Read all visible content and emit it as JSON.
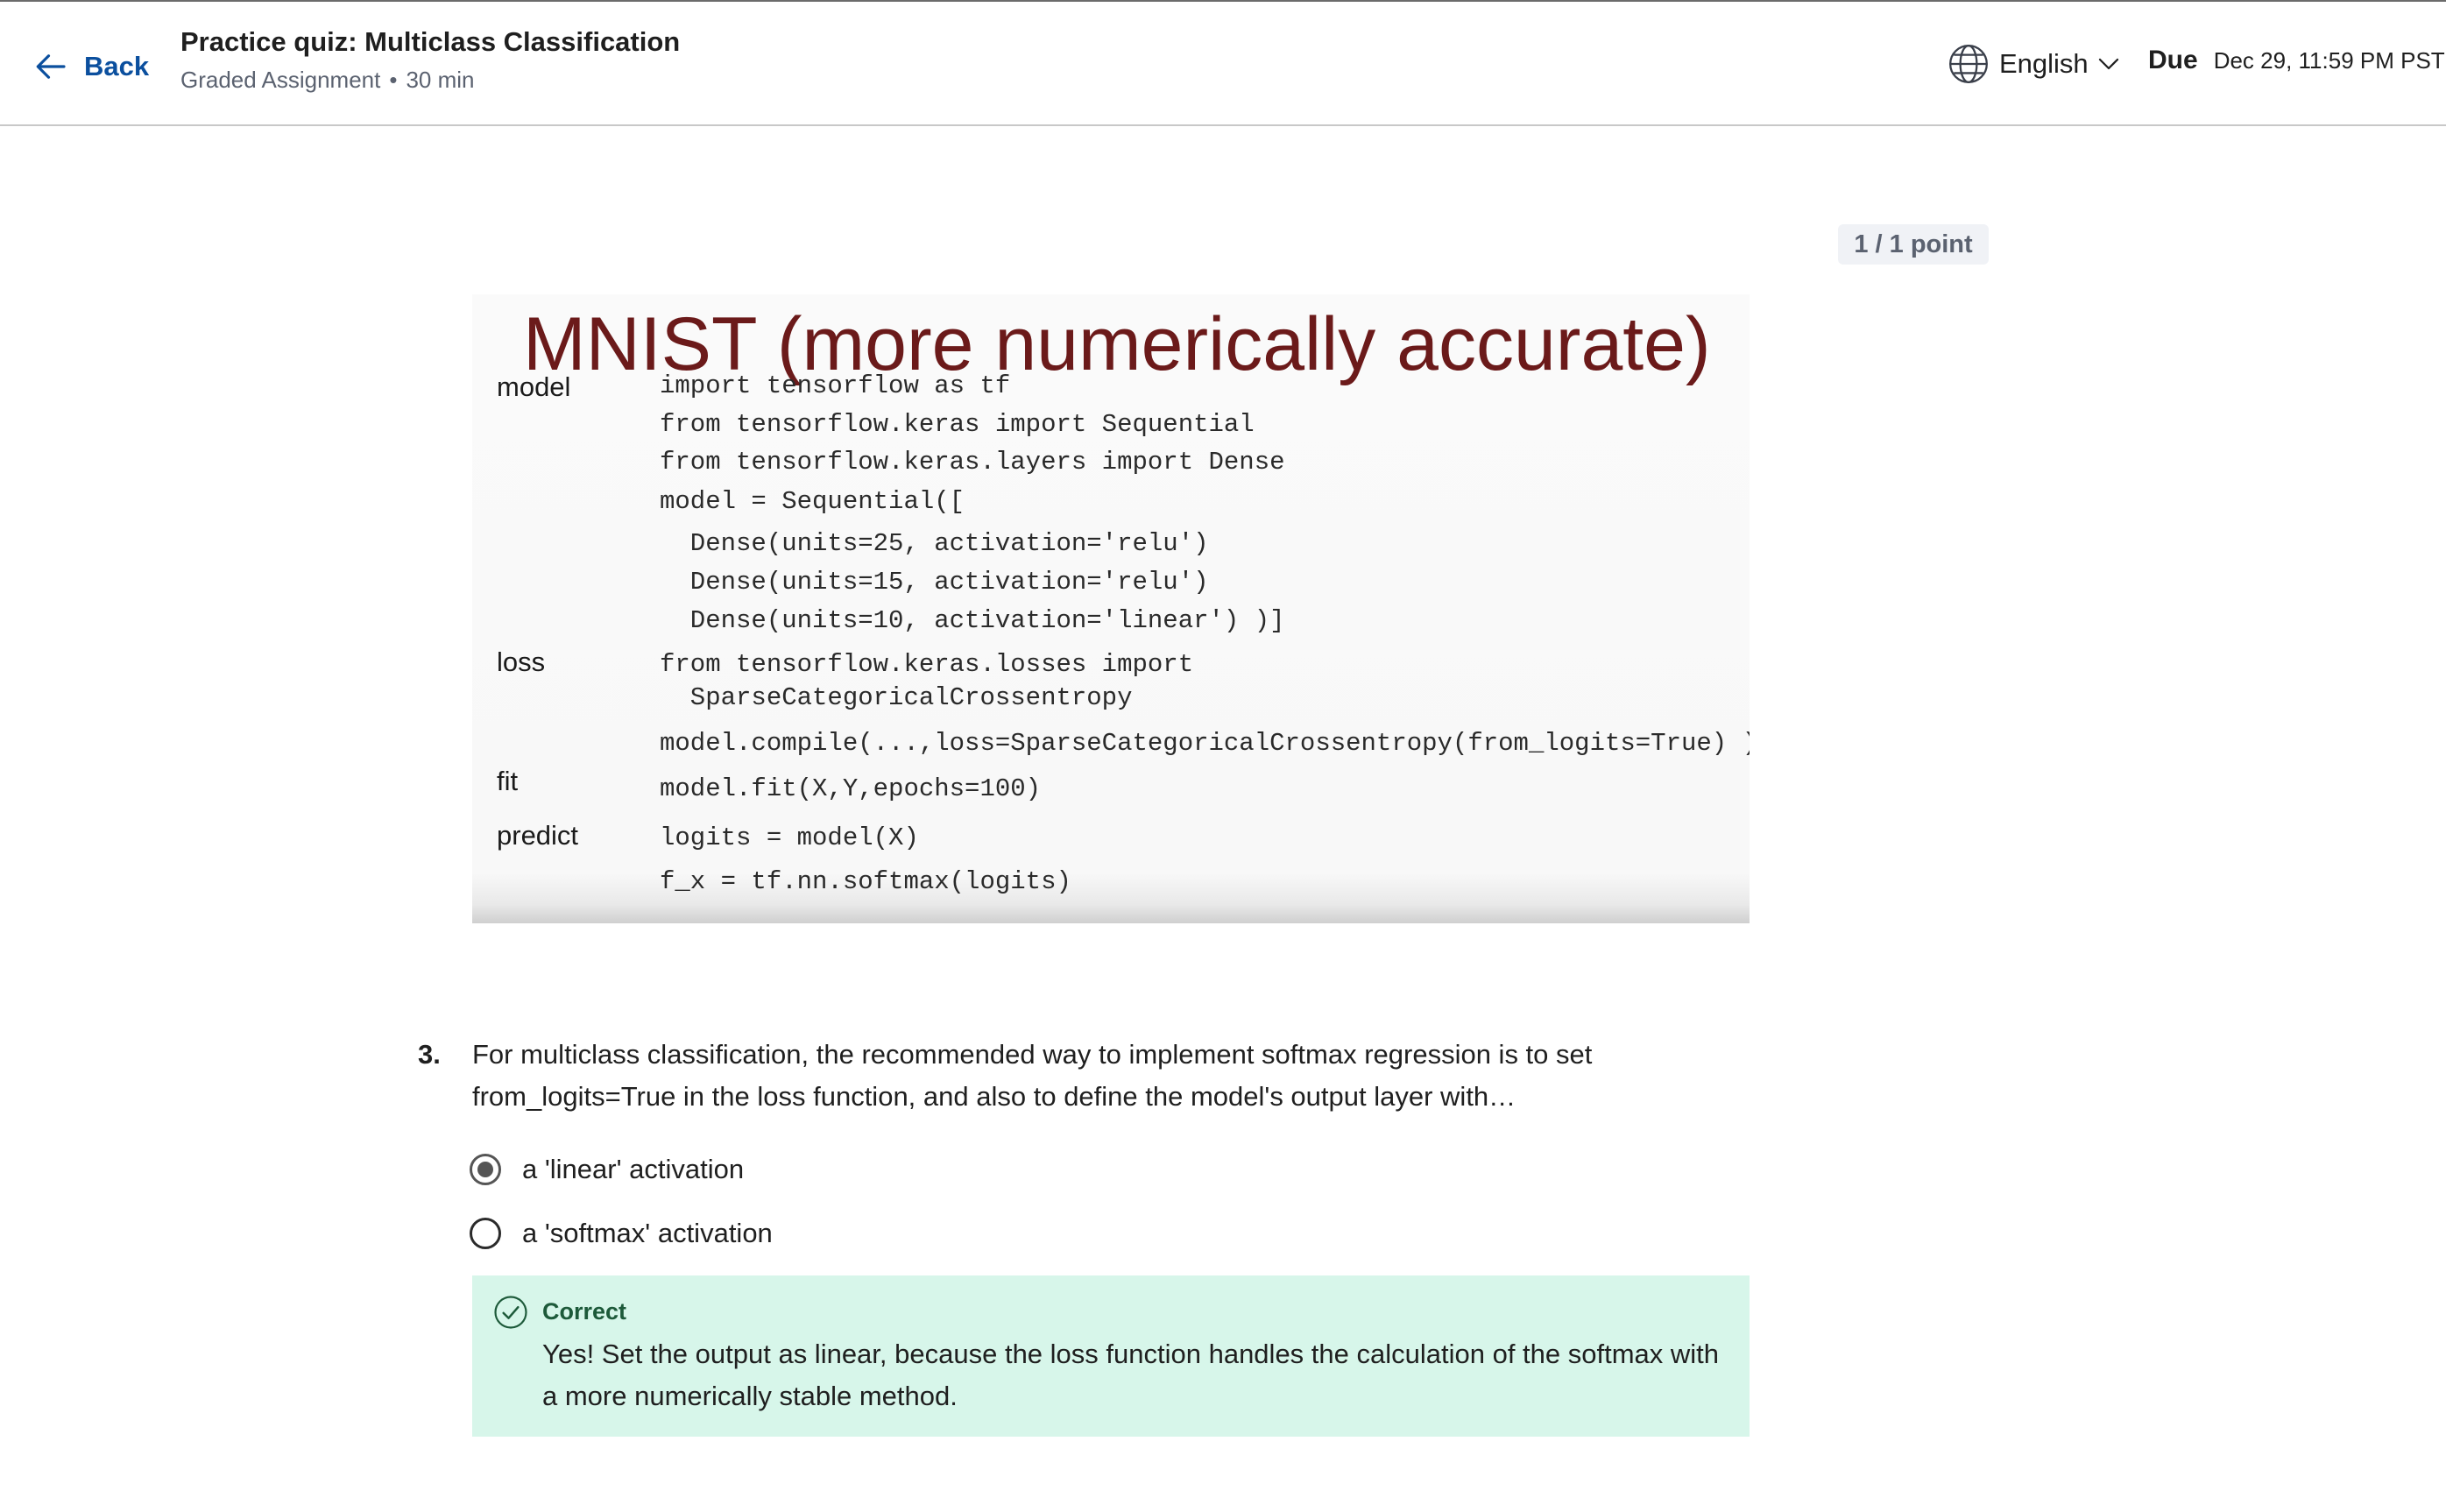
{
  "header": {
    "back_label": "Back",
    "title": "Practice quiz: Multiclass Classification",
    "subtitle_type": "Graded Assignment",
    "subtitle_sep": "•",
    "subtitle_duration": "30 min",
    "language": "English",
    "due_label": "Due",
    "due_date": "Dec 29, 11:59 PM PST"
  },
  "points": "1 / 1 point",
  "slide": {
    "title": "MNIST (more numerically accurate)",
    "labels": {
      "model": "model",
      "loss": "loss",
      "fit": "fit",
      "predict": "predict"
    },
    "code": [
      "import tensorflow as tf",
      "from tensorflow.keras import Sequential",
      "from tensorflow.keras.layers import Dense",
      "model = Sequential([",
      "  Dense(units=25, activation='relu')",
      "  Dense(units=15, activation='relu')",
      "  Dense(units=10, activation='linear') )]",
      "from tensorflow.keras.losses import",
      "  SparseCategoricalCrossentropy",
      "model.compile(...,loss=SparseCategoricalCrossentropy(from_logits=True) )",
      "model.fit(X,Y,epochs=100)",
      "logits = model(X)",
      "f_x = tf.nn.softmax(logits)"
    ]
  },
  "question": {
    "number": "3.",
    "text": "For multiclass classification, the recommended way to implement softmax regression is to set from_logits=True in the loss function, and also to define the model's output layer with…",
    "options": [
      {
        "label": "a 'linear' activation",
        "selected": true
      },
      {
        "label": "a 'softmax' activation",
        "selected": false
      }
    ]
  },
  "feedback": {
    "status": "Correct",
    "text": "Yes! Set the output as linear, because the loss function handles the calculation of the softmax with a more numerically stable method."
  },
  "colors": {
    "link_blue": "#0b4f9e",
    "slide_title": "#6b1a1a",
    "feedback_bg": "#d7f6ea",
    "feedback_title": "#1d5a3a"
  }
}
